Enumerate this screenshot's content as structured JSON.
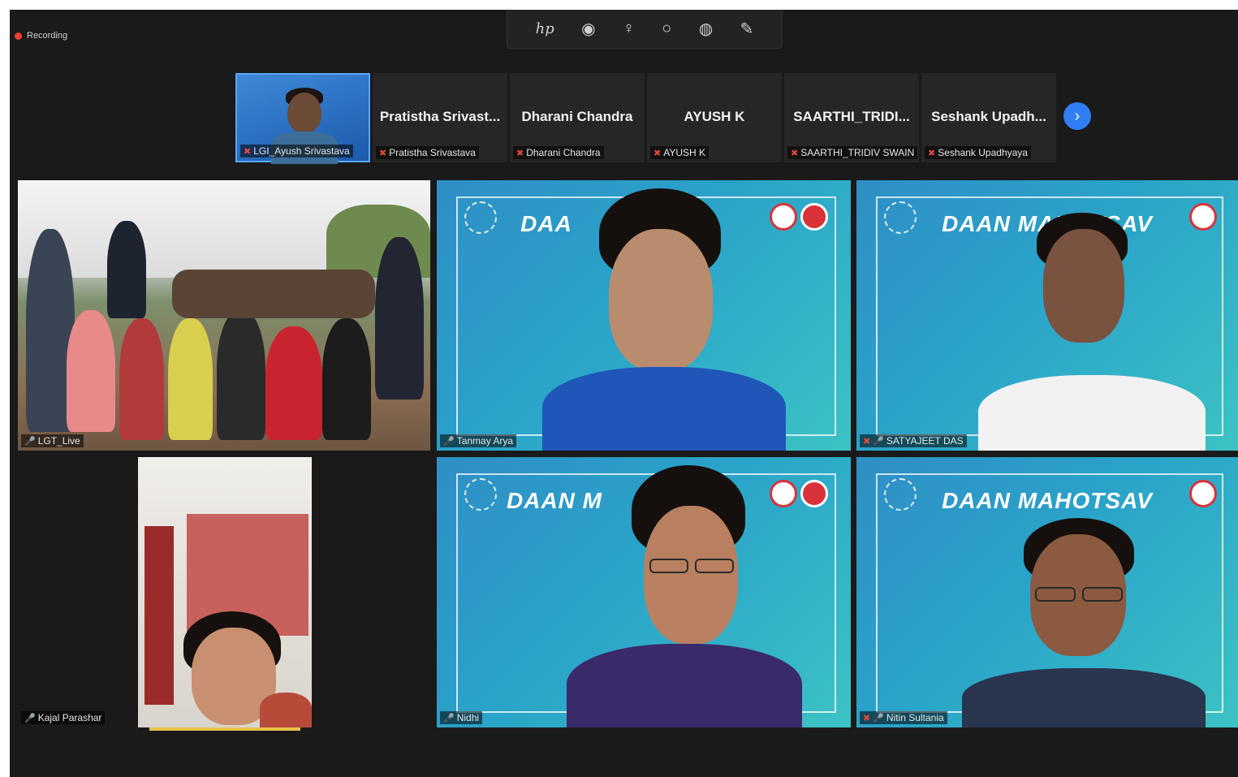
{
  "app": {
    "recording_label": "Recording",
    "floating_toolbar": [
      "hp",
      "◉",
      "♀",
      "○",
      "◍",
      "✎"
    ]
  },
  "strip": {
    "participants": [
      {
        "big_name": "",
        "small_name": "LGI_Ayush Srivastava",
        "mic": "off",
        "video": true
      },
      {
        "big_name": "Pratistha Srivast...",
        "small_name": "Pratistha Srivastava",
        "mic": "off",
        "video": false
      },
      {
        "big_name": "Dharani Chandra",
        "small_name": "Dharani Chandra",
        "mic": "off",
        "video": false
      },
      {
        "big_name": "AYUSH K",
        "small_name": "AYUSH K",
        "mic": "off",
        "video": false
      },
      {
        "big_name": "SAARTHI_TRIDI...",
        "small_name": "SAARTHI_TRIDIV SWAIN",
        "mic": "off",
        "video": false
      },
      {
        "big_name": "Seshank Upadh...",
        "small_name": "Seshank Upadhyaya",
        "mic": "off",
        "video": false
      }
    ],
    "next_icon": "›"
  },
  "gallery": {
    "tiles": [
      {
        "name": "LGT_Live",
        "mic": "on"
      },
      {
        "name": "Tanmay Arya",
        "mic": "on",
        "banner": "DAA"
      },
      {
        "name": "SATYAJEET DAS",
        "mic": "on",
        "banner": "DAAN MAHOTSAV"
      },
      {
        "name": "Kajal Parashar",
        "mic": "on"
      },
      {
        "name": "Nidhi",
        "mic": "on",
        "banner": "DAAN M"
      },
      {
        "name": "Nitin Sultania",
        "mic": "on",
        "banner": "DAAN MAHOTSAV"
      }
    ]
  },
  "colors": {
    "background": "#1a1a1a",
    "accent": "#2f7ef3",
    "banner": "#2aa3c9",
    "mic_off": "#e54a3b"
  }
}
